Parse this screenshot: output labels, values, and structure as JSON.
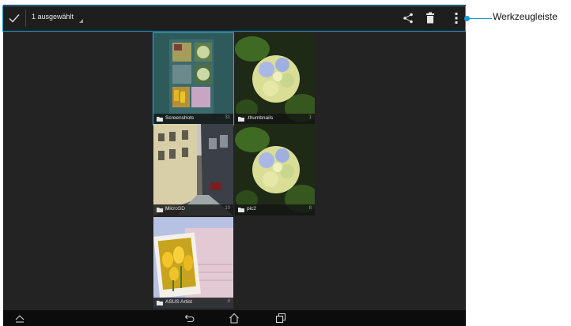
{
  "action_bar": {
    "selection_label": "1 ausgewählt",
    "icons": {
      "done": "check-icon",
      "share": "share-icon",
      "delete": "trash-icon",
      "overflow": "more-vertical-icon"
    }
  },
  "albums": [
    {
      "name": "Screenshots",
      "count": "31",
      "selected": true,
      "thumbnail": "screenshot-collage"
    },
    {
      "name": ".thumbnails",
      "count": "1",
      "selected": false,
      "thumbnail": "hydrangea-flower"
    },
    {
      "name": "MicroSD",
      "count": "10",
      "selected": false,
      "thumbnail": "city-street"
    },
    {
      "name": "pic2",
      "count": "8",
      "selected": false,
      "thumbnail": "hydrangea-flower"
    },
    {
      "name": "ASUS Artist",
      "count": "4",
      "selected": false,
      "thumbnail": "tulips-postcard"
    }
  ],
  "nav_bar": {
    "icons": [
      "collapse-icon",
      "back-icon",
      "home-icon",
      "recent-apps-icon"
    ]
  },
  "callout": {
    "label": "Werkzeugleiste",
    "color": "#1a9ad6"
  },
  "colors": {
    "selection_accent": "#37a6c1",
    "screen_background": "#232323",
    "action_bar_background": "#1e1e1e"
  }
}
